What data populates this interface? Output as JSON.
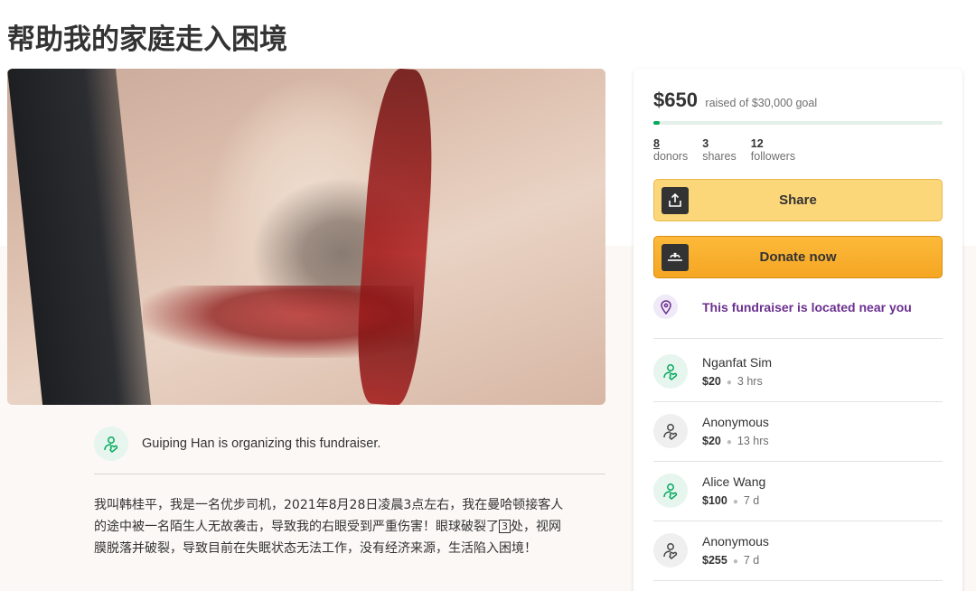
{
  "page": {
    "title": "帮助我的家庭走入困境"
  },
  "organizer": {
    "text": "Guiping Han is organizing this fundraiser."
  },
  "story": {
    "line1": "我叫韩桂平，我是一名优步司机，2021年8月28日凌晨3点左右，我在曼哈顿接客人",
    "line2a": "的途中被一名陌生人无故袭击，导致我的右眼受到严重伤害！眼球破裂了",
    "line2box": "3",
    "line2b": "处，视网",
    "line3": "膜脱落并破裂，导致目前在失眠状态无法工作，没有经济来源，生活陷入困境！"
  },
  "summary": {
    "amount": "$650",
    "goal_text": "raised of $30,000 goal",
    "progress_fraction": 0.0217,
    "donors_count": "8",
    "donors_label": "donors",
    "shares_count": "3",
    "shares_label": "shares",
    "followers_count": "12",
    "followers_label": "followers"
  },
  "buttons": {
    "share": "Share",
    "donate": "Donate now"
  },
  "location": {
    "text": "This fundraiser is located near you"
  },
  "donations": [
    {
      "name": "Nganfat Sim",
      "amount": "$20",
      "time": "3 hrs",
      "avatar": "green"
    },
    {
      "name": "Anonymous",
      "amount": "$20",
      "time": "13 hrs",
      "avatar": "grey"
    },
    {
      "name": "Alice Wang",
      "amount": "$100",
      "time": "7 d",
      "avatar": "green"
    },
    {
      "name": "Anonymous",
      "amount": "$255",
      "time": "7 d",
      "avatar": "grey"
    }
  ],
  "colors": {
    "progress": "#02a95c",
    "share_button": "#fcd77a",
    "donate_button": "#f5a623",
    "location_text": "#6b2f8f",
    "avatar_green_bg": "#e6f5ee"
  },
  "icons": {
    "share": "share-upload-icon",
    "donate": "donate-hand-icon",
    "location": "location-pin-icon",
    "donor_green": "heart-hand-icon",
    "donor_grey": "heart-hand-icon"
  }
}
